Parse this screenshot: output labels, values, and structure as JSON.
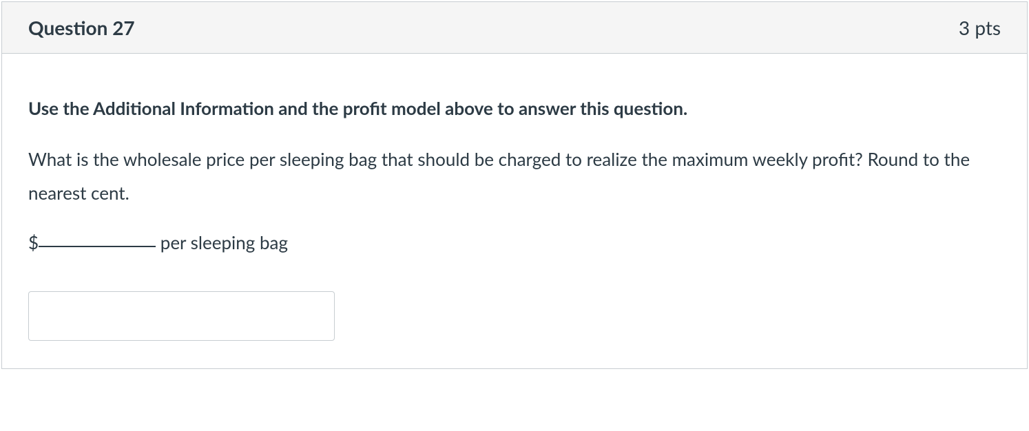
{
  "header": {
    "title": "Question 27",
    "points": "3 pts"
  },
  "body": {
    "instruction": "Use the Additional Information and the profit model above to answer this question.",
    "question": "What is the wholesale price per sleeping bag that should be charged to realize the maximum weekly profit?  Round to the nearest cent.",
    "blank_prefix": "$",
    "blank_suffix": " per sleeping bag"
  },
  "input": {
    "value": ""
  }
}
